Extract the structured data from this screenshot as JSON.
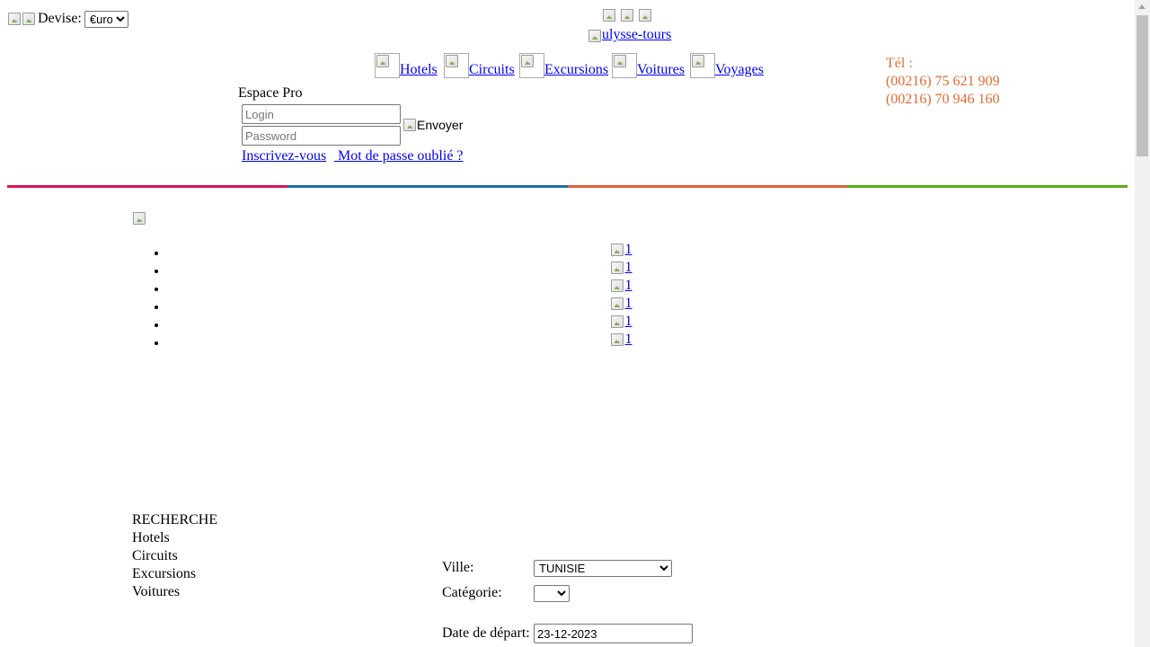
{
  "header": {
    "currency": {
      "label": "Devise:",
      "selected": "€uro"
    },
    "logo_alt": "ulysse-tours",
    "phone": {
      "label": "Tél :",
      "numbers": [
        "(00216) 75 621 909",
        "(00216) 70 946 160"
      ]
    },
    "phone_color": "#e06b2f"
  },
  "nav": {
    "items": [
      {
        "label": "Hotels"
      },
      {
        "label": "Circuits"
      },
      {
        "label": "Excursions"
      },
      {
        "label": "Voitures"
      },
      {
        "label": "Voyages"
      }
    ]
  },
  "espace_pro": {
    "title": "Espace Pro",
    "login_placeholder": "Login",
    "password_placeholder": "Password",
    "submit_alt": "Envoyer",
    "register_link": "Inscrivez-vous",
    "forgot_link": " Mot de passe oublié ?"
  },
  "stripe_colors": [
    "#d4145a",
    "#1b6fa8",
    "#e0623a",
    "#5aae14"
  ],
  "slider": {
    "items": [
      {
        "alt": "1"
      },
      {
        "alt": "1"
      },
      {
        "alt": "1"
      },
      {
        "alt": "1"
      },
      {
        "alt": "1"
      },
      {
        "alt": "1"
      }
    ]
  },
  "search": {
    "title": "RECHERCHE",
    "categories": [
      "Hotels",
      "Circuits",
      "Excursions",
      "Voitures"
    ],
    "form": {
      "ville_label": "Ville:",
      "ville_selected": "TUNISIE",
      "categorie_label": "Catégorie:",
      "categorie_selected": "",
      "date_label": "Date de départ:",
      "date_value": "23-12-2023"
    }
  }
}
